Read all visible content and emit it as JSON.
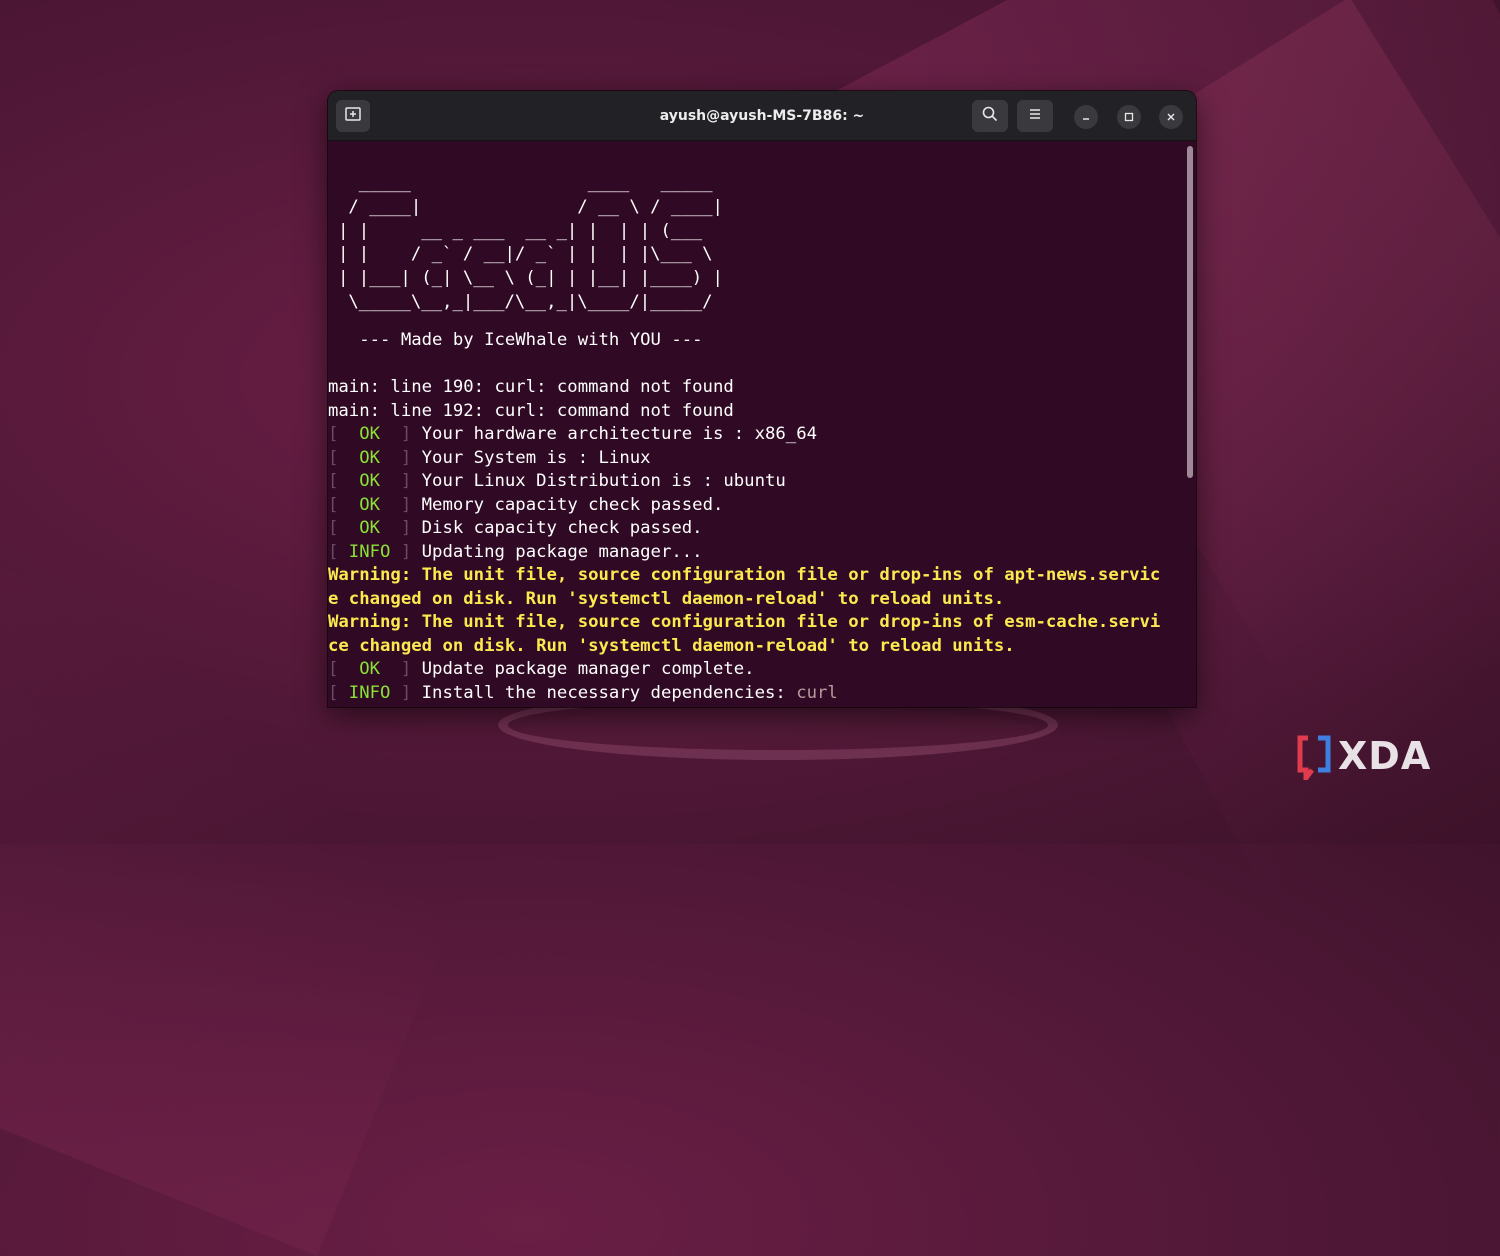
{
  "window": {
    "title": "ayush@ayush-MS-7B86: ~",
    "icons": {
      "new_tab": "new-tab-icon",
      "search": "search-icon",
      "menu": "hamburger-menu-icon",
      "minimize": "minimize-icon",
      "maximize": "maximize-icon",
      "close": "close-icon"
    }
  },
  "terminal": {
    "ascii_art": [
      "  _____                 ____   _____ ",
      " / ____|               / __ \\ / ____|",
      "| |     __ _ ___  __ _| |  | | (___  ",
      "| |    / _` / __|/ _` | |  | |\\___ \\ ",
      "| |___| (_| \\__ \\ (_| | |__| |____) |",
      " \\_____\\__,_|___/\\__,_|\\____/|_____/ "
    ],
    "made_by": "   --- Made by IceWhale with YOU ---",
    "errors": [
      "main: line 190: curl: command not found",
      "main: line 192: curl: command not found"
    ],
    "status_lines": [
      {
        "tag": "OK",
        "text": "Your hardware architecture is : x86_64"
      },
      {
        "tag": "OK",
        "text": "Your System is : Linux"
      },
      {
        "tag": "OK",
        "text": "Your Linux Distribution is : ubuntu"
      },
      {
        "tag": "OK",
        "text": "Memory capacity check passed."
      },
      {
        "tag": "OK",
        "text": "Disk capacity check passed."
      },
      {
        "tag": "INFO",
        "text": "Updating package manager..."
      }
    ],
    "warnings": [
      "Warning: The unit file, source configuration file or drop-ins of apt-news.servic",
      "e changed on disk. Run 'systemctl daemon-reload' to reload units.",
      "Warning: The unit file, source configuration file or drop-ins of esm-cache.servi",
      "ce changed on disk. Run 'systemctl daemon-reload' to reload units."
    ],
    "final_lines": [
      {
        "tag": "OK",
        "text": "Update package manager complete."
      },
      {
        "tag": "INFO",
        "text": "Install the necessary dependencies: ",
        "dep": "curl"
      }
    ],
    "bracket_open": "[",
    "bracket_close": "]",
    "ok_label": "  OK  ",
    "info_label": " INFO "
  },
  "watermark": {
    "text": "XDA"
  },
  "colors": {
    "terminal_bg": "#300a24",
    "titlebar_bg": "#222226",
    "ok_green": "#8ae234",
    "warning_yellow": "#fce94f",
    "wallpaper": "#5a1a3c"
  }
}
